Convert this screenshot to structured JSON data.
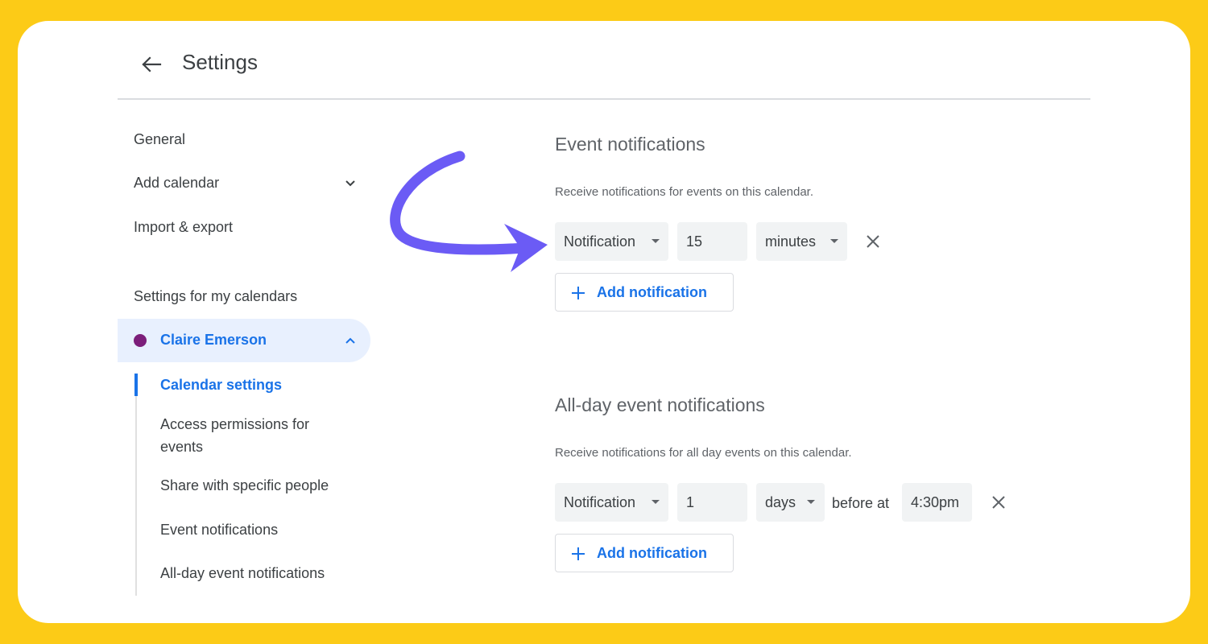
{
  "colors": {
    "background": "#FCCB17",
    "accent": "#1a73e8",
    "active_bg": "#e8f0fe",
    "calendar_dot": "#7B1E7A",
    "annotation_arrow": "#6B5BF5"
  },
  "header": {
    "back_icon": "arrow-left-icon",
    "title": "Settings"
  },
  "sidebar": {
    "items": [
      {
        "label": "General"
      },
      {
        "label": "Add calendar",
        "icon": "chevron-down-icon"
      },
      {
        "label": "Import & export"
      }
    ],
    "section_heading": "Settings for my calendars",
    "calendar": {
      "name": "Claire Emerson",
      "icon": "chevron-up-icon",
      "subitems": [
        {
          "label": "Calendar settings",
          "active": true
        },
        {
          "label": "Access permissions for events"
        },
        {
          "label": "Share with specific people"
        },
        {
          "label": "Event notifications"
        },
        {
          "label": "All-day event notifications"
        }
      ]
    }
  },
  "event_notifications": {
    "title": "Event notifications",
    "description": "Receive notifications for events on this calendar.",
    "row": {
      "type": "Notification",
      "amount": "15",
      "unit": "minutes",
      "remove_icon": "close-icon"
    },
    "add_label": "Add notification"
  },
  "allday_notifications": {
    "title": "All-day event notifications",
    "description": "Receive notifications for all day events on this calendar.",
    "row": {
      "type": "Notification",
      "amount": "1",
      "unit": "days",
      "before_text": "before at",
      "time": "4:30pm",
      "remove_icon": "close-icon"
    },
    "add_label": "Add notification"
  }
}
